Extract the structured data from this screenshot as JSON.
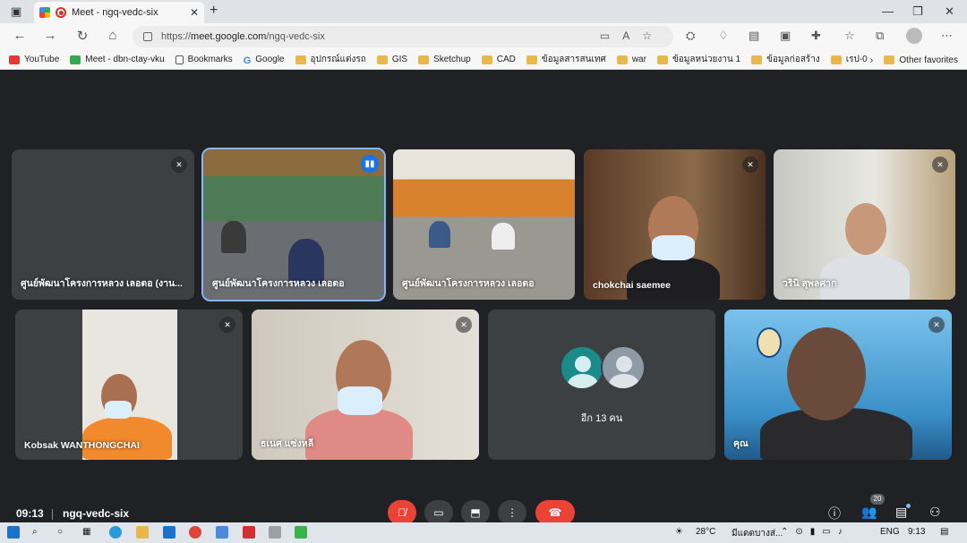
{
  "browser": {
    "tab_title": "Meet - ngq-vedc-six",
    "tab_close": "✕",
    "new_tab": "+",
    "url_prefix": "https://",
    "url_host": "meet.google.com",
    "url_path": "/ngq-vedc-six",
    "window": {
      "minimize": "—",
      "maximize": "❐",
      "close": "✕"
    },
    "bookmarks": [
      {
        "label": "YouTube",
        "icon": "youtube-icon"
      },
      {
        "label": "Meet - dbn-ctay-vku",
        "icon": "meet-icon"
      },
      {
        "label": "Bookmarks",
        "icon": "page-icon"
      },
      {
        "label": "Google",
        "icon": "google-icon"
      },
      {
        "label": "อุปกรณ์แต่งรถ",
        "icon": "folder-icon"
      },
      {
        "label": "GIS",
        "icon": "folder-icon"
      },
      {
        "label": "Sketchup",
        "icon": "folder-icon"
      },
      {
        "label": "CAD",
        "icon": "folder-icon"
      },
      {
        "label": "ข้อมูลสารสนเทศ",
        "icon": "folder-icon"
      },
      {
        "label": "war",
        "icon": "folder-icon"
      },
      {
        "label": "ข้อมูลหน่วยงาน 1",
        "icon": "folder-icon"
      },
      {
        "label": "ข้อมูลก่อสร้าง",
        "icon": "folder-icon"
      },
      {
        "label": "เรป-0",
        "icon": "folder-icon"
      }
    ],
    "other_favorites": "Other favorites"
  },
  "meet": {
    "tiles": [
      {
        "name": "ศูนย์พัฒนาโครงการหลวง เลอตอ (งาน...",
        "muted": true
      },
      {
        "name": "ศูนย์พัฒนาโครงการหลวง เลอตอ",
        "speaking": true
      },
      {
        "name": "ศูนย์พัฒนาโครงการหลวง เลอตอ"
      },
      {
        "name": "chokchai saemee",
        "muted": true
      },
      {
        "name": "วรินิ สุพลศาก",
        "muted": true
      },
      {
        "name": "Kobsak WANTHONGCHAI",
        "muted": true
      },
      {
        "name": "ธเนศ แซ่งหลี",
        "muted": true
      },
      {
        "name": "อีก 13 คน"
      },
      {
        "name": "คุณ",
        "muted": true
      }
    ],
    "clock": "09:13",
    "meeting_code": "ngq-vedc-six",
    "participants_badge": "20"
  },
  "taskbar": {
    "weather": "28°C",
    "weather_text": "มีแดดบางส่...",
    "lang": "ENG",
    "time": "9:13"
  }
}
